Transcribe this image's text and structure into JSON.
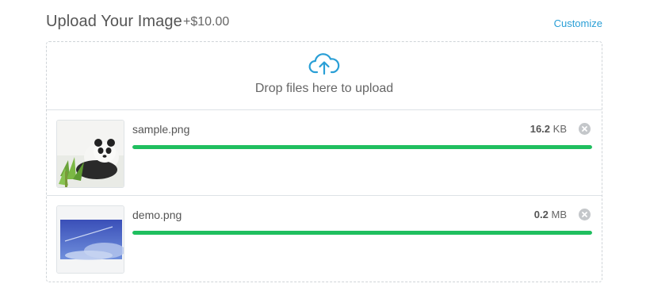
{
  "header": {
    "title": "Upload Your Image",
    "price": "+$10.00",
    "customize_label": "Customize"
  },
  "dropzone": {
    "icon": "cloud-upload-icon",
    "text": "Drop files here to upload"
  },
  "files": [
    {
      "name": "sample.png",
      "size_value": "16.2",
      "size_unit": "KB",
      "progress": 1.0,
      "thumbnail": "panda-image",
      "remove_icon": "close-circle-icon"
    },
    {
      "name": "demo.png",
      "size_value": "0.2",
      "size_unit": "MB",
      "progress": 1.0,
      "thumbnail": "sky-image",
      "remove_icon": "close-circle-icon"
    }
  ],
  "colors": {
    "accent": "#2a9fd6",
    "progress": "#1fbf5f",
    "text": "#555555",
    "border": "#cfd4d8"
  }
}
